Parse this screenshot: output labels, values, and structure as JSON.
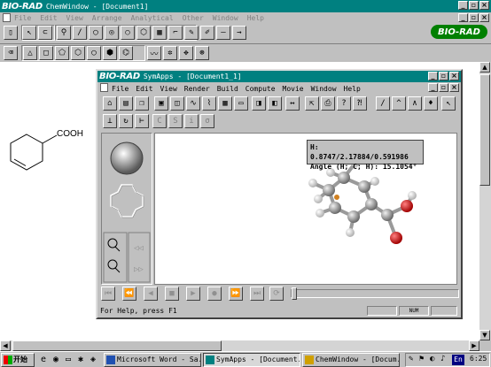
{
  "chemwindow": {
    "title_brand": "BIO-RAD",
    "title": "ChemWindow - [Document1]",
    "menu": [
      "File",
      "Edit",
      "View",
      "Arrange",
      "Analytical",
      "Other",
      "Window",
      "Help"
    ],
    "badge": "BIO-RAD",
    "structure_label": "COOH"
  },
  "symapps": {
    "title_brand": "BIO-RAD",
    "title": "SymApps - [Document1_1]",
    "menu": [
      "File",
      "Edit",
      "View",
      "Render",
      "Build",
      "Compute",
      "Movie",
      "Window",
      "Help"
    ],
    "tooltip_line1": "H: 0.8747/2.17884/0.591986",
    "tooltip_line2": "Angle (H; C; H): 15.1054°",
    "status_text": "For Help, press F1",
    "status_num": "NUM"
  },
  "taskbar": {
    "start": "开始",
    "tasks": [
      {
        "label": "Microsoft Word - Sa...",
        "active": false
      },
      {
        "label": "SymApps - [Document...",
        "active": true
      },
      {
        "label": "ChemWindow - [Docum...",
        "active": false
      }
    ],
    "lang": "En",
    "clock": "6:25"
  },
  "colors": {
    "titlebar": "#008080",
    "badge_green": "#008000",
    "atom_oxygen": "#d00000",
    "atom_carbon": "#8a8a8a",
    "atom_hydrogen": "#f0f0f0"
  }
}
